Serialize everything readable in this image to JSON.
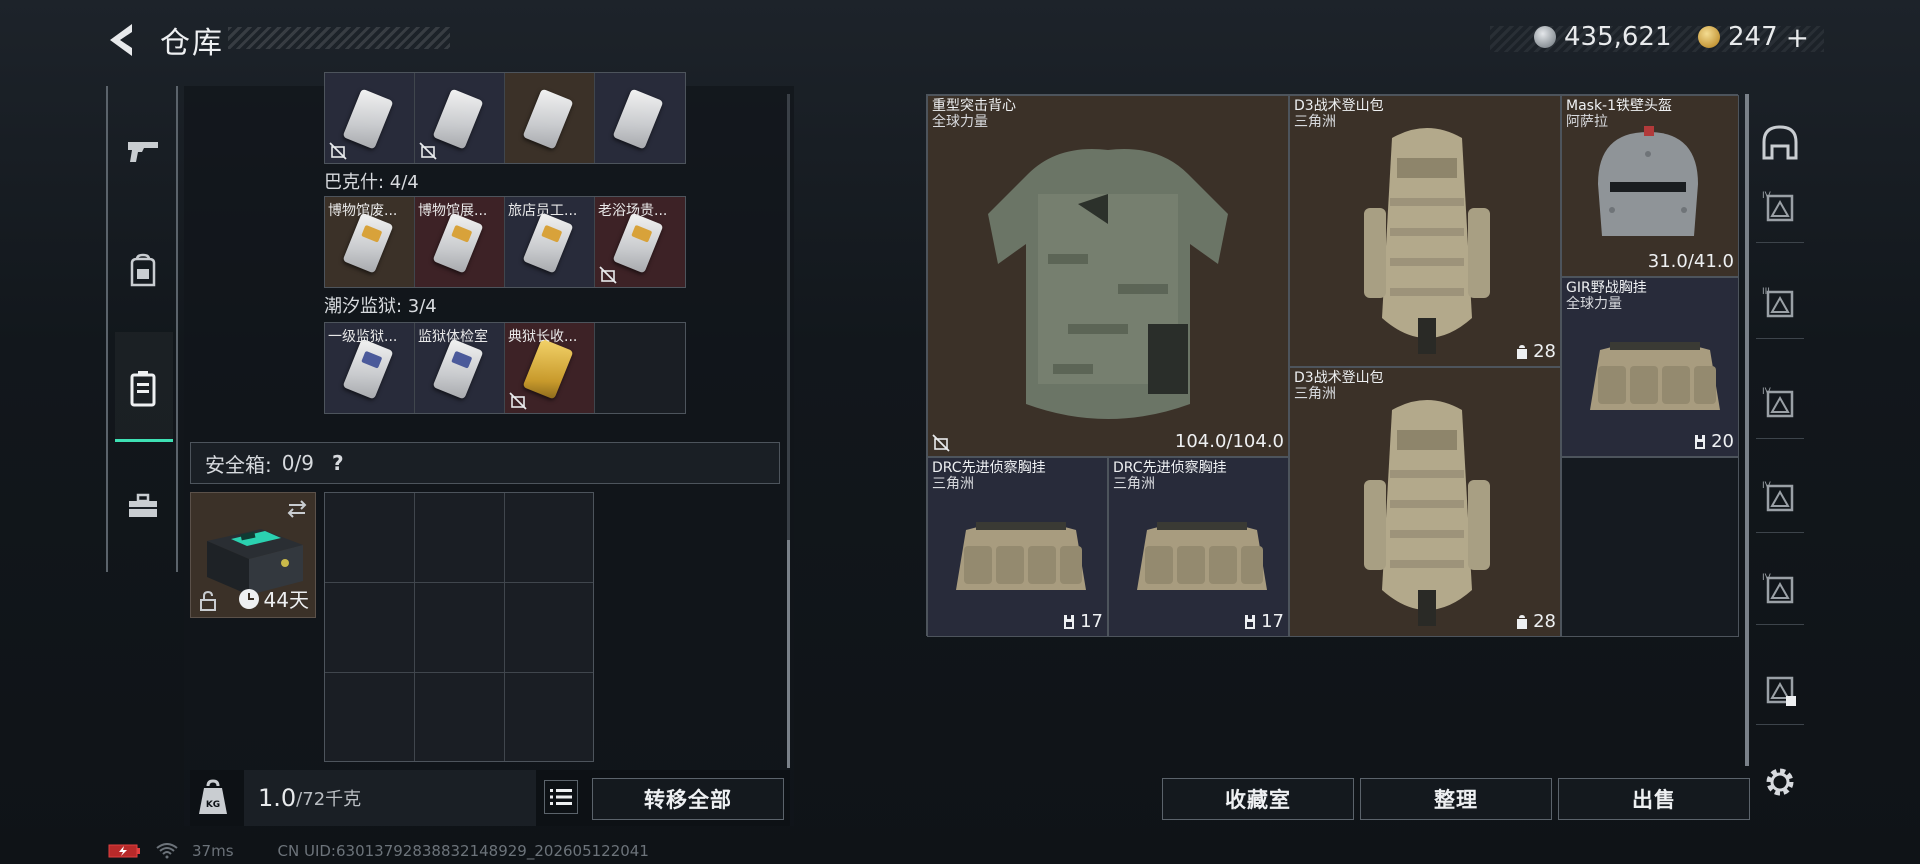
{
  "header": {
    "back_icon": "back-arrow-icon",
    "title": "仓库"
  },
  "currency": {
    "silver": {
      "icon": "silver-coin-icon",
      "value": "435,621",
      "color": "#9aa0a6"
    },
    "gold": {
      "icon": "gold-coin-icon",
      "value": "247",
      "plus": "+",
      "color": "#c9a24a"
    }
  },
  "sidebar": {
    "items": [
      {
        "icon": "pistol-icon",
        "active": false
      },
      {
        "icon": "backpack-icon",
        "active": false
      },
      {
        "icon": "case-icon",
        "active": true
      },
      {
        "icon": "toolbox-icon",
        "active": false
      }
    ],
    "accent": "#3ee0b4"
  },
  "keys": {
    "row0": [
      {
        "label": "",
        "color": "navy",
        "card": "plain",
        "no_sell": true
      },
      {
        "label": "",
        "color": "navy",
        "card": "plain",
        "no_sell": true
      },
      {
        "label": "",
        "color": "brown",
        "card": "plain",
        "no_sell": false
      },
      {
        "label": "",
        "color": "navy",
        "card": "plain",
        "no_sell": false
      }
    ],
    "section1": "巴克什: 4/4",
    "row1": [
      {
        "label": "博物馆废...",
        "color": "brown",
        "card": "gold",
        "no_sell": false
      },
      {
        "label": "博物馆展...",
        "color": "red",
        "card": "gold",
        "no_sell": false
      },
      {
        "label": "旅店员工...",
        "color": "navy",
        "card": "gold",
        "no_sell": false
      },
      {
        "label": "老浴场贵...",
        "color": "red",
        "card": "gold",
        "no_sell": true
      }
    ],
    "section2": "潮汐监狱: 3/4",
    "row2": [
      {
        "label": "一级监狱...",
        "color": "navy",
        "card": "blue",
        "no_sell": false
      },
      {
        "label": "监狱体检室",
        "color": "navy",
        "card": "blue",
        "no_sell": false
      },
      {
        "label": "典狱长收...",
        "color": "red",
        "card": "goldcard",
        "no_sell": true
      },
      {
        "label": "",
        "color": "empty",
        "card": "",
        "no_sell": false
      }
    ]
  },
  "safebox": {
    "label": "安全箱:",
    "count": "0/9",
    "help": "?",
    "item": {
      "icon": "safebox-case-icon",
      "swap_icon": "swap-icon",
      "lock_icon": "lock-icon",
      "timer_icon": "clock-icon",
      "days": "44天"
    }
  },
  "weight": {
    "icon": "weight-icon",
    "value": "1.0",
    "unit": "/72千克"
  },
  "left_actions": {
    "list_icon": "list-icon",
    "transfer_all": "转移全部"
  },
  "stash": [
    {
      "name": "重型突击背心",
      "sub": "全球力量",
      "value": "104.0/104.0",
      "value_icon": "",
      "no_sell": true,
      "color": "brown",
      "art": "vest"
    },
    {
      "name": "D3战术登山包",
      "sub": "三角洲",
      "value": "28",
      "value_icon": "bag-capacity-icon",
      "no_sell": false,
      "color": "brown",
      "art": "pack"
    },
    {
      "name": "Mask-1铁壁头盔",
      "sub": "阿萨拉",
      "value": "31.0/41.0",
      "value_icon": "",
      "no_sell": false,
      "color": "brown",
      "art": "helmet"
    },
    {
      "name": "GIR野战胸挂",
      "sub": "全球力量",
      "value": "20",
      "value_icon": "rig-capacity-icon",
      "no_sell": false,
      "color": "navy",
      "art": "rig"
    },
    {
      "name": "D3战术登山包",
      "sub": "三角洲",
      "value": "28",
      "value_icon": "bag-capacity-icon",
      "no_sell": false,
      "color": "brown",
      "art": "pack"
    },
    {
      "name": "DRC先进侦察胸挂",
      "sub": "三角洲",
      "value": "17",
      "value_icon": "rig-capacity-icon",
      "no_sell": false,
      "color": "navy",
      "art": "rig"
    },
    {
      "name": "DRC先进侦察胸挂",
      "sub": "三角洲",
      "value": "17",
      "value_icon": "rig-capacity-icon",
      "no_sell": false,
      "color": "navy",
      "art": "rig"
    }
  ],
  "right_actions": {
    "collection": "收藏室",
    "sort": "整理",
    "sell": "出售"
  },
  "right_side": {
    "icons": [
      "helmet-slot-icon",
      "armor-slot-icon",
      "chest-rig-slot-icon",
      "backpack-slot-icon",
      "slot-icon",
      "slot-icon",
      "stash-expand-icon",
      "settings-gear-icon"
    ],
    "tiers": [
      "",
      "IV",
      "III",
      "IV",
      "IV",
      "IV",
      "",
      ""
    ]
  },
  "status": {
    "battery_icon": "battery-charging-icon",
    "wifi_icon": "wifi-icon",
    "ping": "37ms",
    "uid": "CN UID:6301379283883214892​9_202605122041"
  }
}
